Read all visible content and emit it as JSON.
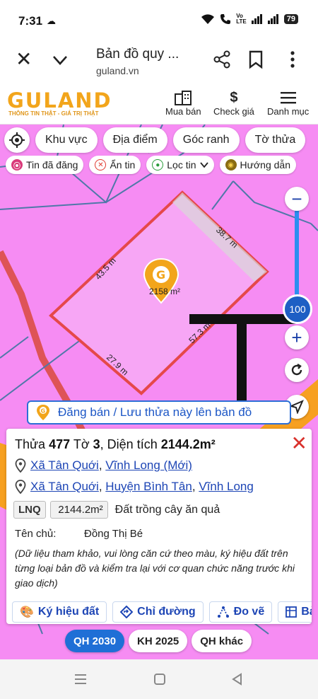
{
  "status_bar": {
    "time": "7:31",
    "volte_top": "Vo",
    "volte_bottom": "LTE",
    "battery": "79"
  },
  "browser": {
    "title": "Bản đồ quy ...",
    "domain": "guland.vn"
  },
  "app_header": {
    "logo": "GULAND",
    "tagline": "THÔNG TIN THẬT - GIÁ TRỊ THẬT",
    "items": [
      {
        "label": "Mua bán",
        "icon": "building-icon"
      },
      {
        "label": "Check giá",
        "icon": "dollar-icon"
      },
      {
        "label": "Danh mục",
        "icon": "menu-icon"
      }
    ]
  },
  "filters": {
    "primary": [
      "Khu vực",
      "Địa điểm",
      "Góc ranh",
      "Tờ thửa"
    ],
    "secondary": [
      {
        "label": "Tin đã đăng",
        "icon": "map-pin-icon",
        "color": "#d93a7a"
      },
      {
        "label": "Ẩn tin",
        "icon": "close-circle-icon",
        "color": "#e0392f"
      },
      {
        "label": "Lọc tin",
        "icon": "location-icon",
        "color": "#2a9c3a"
      },
      {
        "label": "Hướng dẫn",
        "icon": "guide-icon",
        "color": "#8a6d12"
      }
    ]
  },
  "map": {
    "edges": [
      "38.7 m",
      "43.5 m",
      "57.3 m",
      "27.9 m"
    ],
    "parcel_area_label": "2158 m²",
    "zoom_level": "100",
    "land_color": "#f68cf3",
    "road_color": "#f7a020",
    "parcel_outline": "#e5484a"
  },
  "post_banner": "Đăng bán / Lưu thửa này lên bản đồ",
  "parcel": {
    "title_prefix": "Thửa",
    "lot": "477",
    "sheet_prefix": "Tờ",
    "sheet": "3",
    "area_prefix": ", Diện tích",
    "area": "2144.2m²",
    "address_new": {
      "commune": "Xã Tân Quới",
      "province": "Vĩnh Long (Mới)"
    },
    "address_old": {
      "commune": "Xã Tân Quới",
      "district": "Huyện Bình Tân",
      "province": "Vĩnh Long"
    },
    "land_code": "LNQ",
    "land_area": "2144.2m²",
    "land_desc": "Đất trồng cây ăn quả",
    "owner_label": "Tên chủ:",
    "owner_name": "Đồng Thị Bé",
    "note": "(Dữ liệu tham khảo, vui lòng căn cứ theo màu, ký hiệu đất trên từng loại bản đồ và kiểm tra lại với cơ quan chức năng trước khi giao dịch)"
  },
  "actions": [
    {
      "label": "Ký hiệu đất",
      "icon": "palette-icon"
    },
    {
      "label": "Chỉ đường",
      "icon": "directions-icon"
    },
    {
      "label": "Đo vẽ",
      "icon": "measure-icon"
    },
    {
      "label": "Bảng",
      "icon": "table-icon"
    }
  ],
  "plan_toggles": [
    {
      "label": "QH 2030",
      "active": true
    },
    {
      "label": "KH 2025",
      "active": false
    },
    {
      "label": "QH khác",
      "active": false
    }
  ]
}
